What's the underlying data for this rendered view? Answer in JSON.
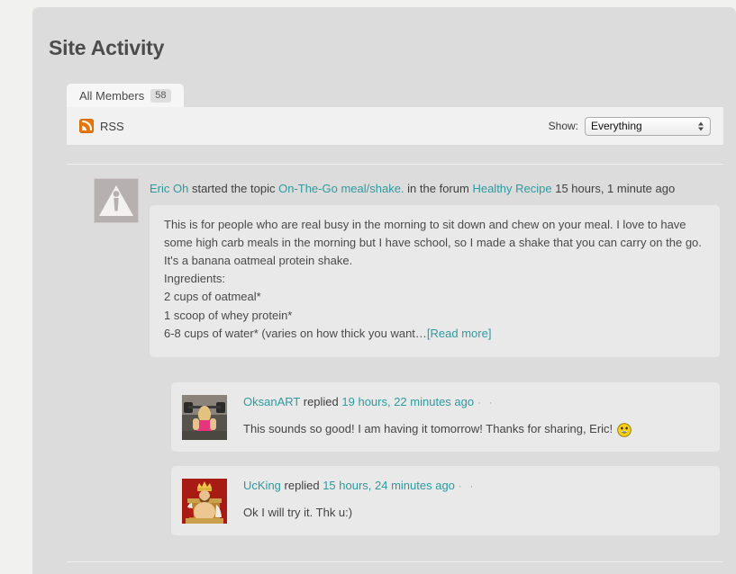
{
  "page": {
    "title": "Site Activity"
  },
  "tabs": [
    {
      "label": "All Members",
      "count": "58",
      "name": "tab-all-members"
    }
  ],
  "toolbar": {
    "rss_label": "RSS",
    "rss_icon": "rss-icon",
    "show_label": "Show:",
    "show_selected": "Everything",
    "show_options": [
      "Everything"
    ]
  },
  "activity": {
    "avatar_icon": "warning-triangle-avatar",
    "head": {
      "author": "Eric Oh",
      "action_1": "started the topic",
      "topic": "On-The-Go meal/shake.",
      "action_2": "in the forum",
      "forum": "Healthy Recipe",
      "timestamp": "15 hours, 1 minute ago"
    },
    "body_lines": [
      "This is for people who are real busy in the morning to sit down and chew on your meal. I love to have some high carb meals in the morning but I have school, so I made a shake that you can carry on the go. It's a banana oatmeal protein shake.",
      "Ingredients:",
      "2 cups of oatmeal*",
      "1 scoop of whey protein*"
    ],
    "body_last_line": "6-8 cups of water* (varies on how thick you want…",
    "read_more": "[Read more]"
  },
  "comments": [
    {
      "author": "OksanART",
      "action": "replied",
      "timestamp": "19 hours, 22 minutes ago",
      "separator": "· ·",
      "text": "This sounds so good! I am having it tomorrow! Thanks for sharing, Eric!",
      "emoji": "grinning-face-emoji",
      "avatar": "oksanart-avatar-photo"
    },
    {
      "author": "UcKing",
      "action": "replied",
      "timestamp": "15 hours, 24 minutes ago",
      "separator": "· ·",
      "text": "Ok I will try it. Thk u:)",
      "emoji": "",
      "avatar": "ucking-avatar-photo"
    }
  ],
  "colors": {
    "link": "#2f9a9e",
    "rss_orange": "#e8760f",
    "page_background": "#f1f1ef",
    "container_background": "#dcdcdc",
    "card_background": "#e9e9e9",
    "title_text": "#4c4c4c"
  }
}
